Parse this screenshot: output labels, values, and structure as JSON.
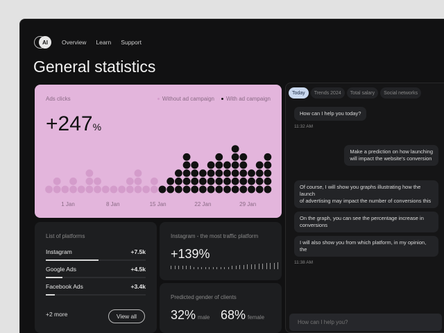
{
  "nav": {
    "logo": "AI",
    "items": [
      "Overview",
      "Learn",
      "Support"
    ]
  },
  "title": "General statistics",
  "ads": {
    "label": "Ads clicks",
    "legend_without": "Without ad campaign",
    "legend_with": "With ad campaign",
    "value": "+247",
    "unit": "%",
    "colors": {
      "card": "#e3b5dc",
      "without": "#d49ccb",
      "with": "#111111"
    },
    "chart_data": {
      "type": "dot-column",
      "x_labels": [
        "1 Jan",
        "8 Jan",
        "15 Jan",
        "22 Jan",
        "29 Jan"
      ],
      "series": [
        {
          "name": "Without ad campaign",
          "values": [
            1,
            2,
            1,
            2,
            1,
            3,
            2,
            1,
            1,
            1,
            2,
            3,
            1,
            2
          ]
        },
        {
          "name": "With ad campaign",
          "values": [
            1,
            2,
            3,
            5,
            4,
            3,
            4,
            5,
            4,
            6,
            5,
            3,
            4,
            5
          ]
        }
      ]
    }
  },
  "platforms": {
    "label": "List of platforms",
    "items": [
      {
        "name": "Instagram",
        "value": "+7.5k",
        "fraction": 0.53
      },
      {
        "name": "Google Ads",
        "value": "+4.5k",
        "fraction": 0.17
      },
      {
        "name": "Facebook Ads",
        "value": "+3.4k",
        "fraction": 0.09
      }
    ],
    "more": "+2 more",
    "view_all": "View all"
  },
  "instagram": {
    "label": "Instagram - the most traffic platform",
    "value": "+139%"
  },
  "gender": {
    "label": "Predicted gender of clients",
    "male_value": "32%",
    "male_label": "male",
    "female_value": "68%",
    "female_label": "female"
  },
  "chat": {
    "tabs": [
      "Today",
      "Trends 2024",
      "Total salary",
      "Social networks"
    ],
    "active_tab": 0,
    "messages": [
      {
        "text": "How can I help you today?",
        "time": "11:32 AM"
      },
      {
        "text": "Make a prediction on how launching\nwill impact the website's conversion"
      },
      {
        "text": "Of course, I will show you graphs illustrating how the launch\nof advertising may impact the number of conversions this"
      },
      {
        "text": "On the graph, you can see the percentage increase in conversions"
      },
      {
        "text": "I will also show you from which platform, in my opinion, the",
        "time": "11:38 AM"
      }
    ],
    "placeholder": "How can I help you?"
  }
}
